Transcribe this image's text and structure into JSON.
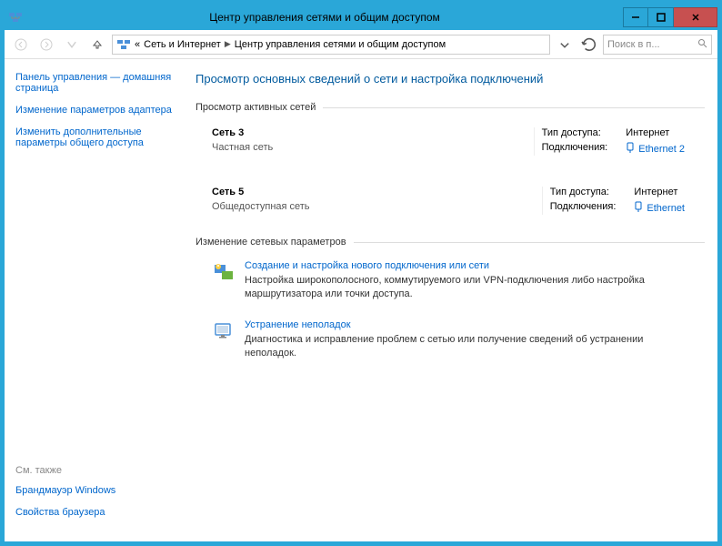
{
  "titlebar": {
    "title": "Центр управления сетями и общим доступом"
  },
  "breadcrumbs": {
    "back": "«",
    "b0": "Сеть и Интернет",
    "b1": "Центр управления сетями и общим доступом"
  },
  "search": {
    "placeholder": "Поиск в п..."
  },
  "sidebar": {
    "home": "Панель управления — домашняя страница",
    "adapter": "Изменение параметров адаптера",
    "sharing": "Изменить дополнительные параметры общего доступа",
    "also": "См. также",
    "firewall": "Брандмауэр Windows",
    "inetopts": "Свойства браузера"
  },
  "main": {
    "title": "Просмотр основных сведений о сети и настройка подключений",
    "active_head": "Просмотр активных сетей",
    "change_head": "Изменение сетевых параметров",
    "k_access": "Тип доступа:",
    "k_conn": "Подключения:",
    "net1": {
      "name": "Сеть 3",
      "type": "Частная сеть",
      "access": "Интернет",
      "conn": "Ethernet 2"
    },
    "net2": {
      "name": "Сеть 5",
      "type": "Общедоступная сеть",
      "access": "Интернет",
      "conn": "Ethernet"
    },
    "act1": {
      "title": "Создание и настройка нового подключения или сети",
      "desc": "Настройка широкополосного, коммутируемого или VPN-подключения либо настройка маршрутизатора или точки доступа."
    },
    "act2": {
      "title": "Устранение неполадок",
      "desc": "Диагностика и исправление проблем с сетью или получение сведений об устранении неполадок."
    }
  }
}
